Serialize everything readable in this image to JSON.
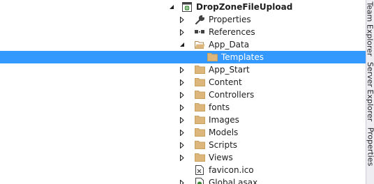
{
  "solution_explorer": {
    "project": {
      "name": "DropZoneFileUpload",
      "expanded": true,
      "icon": "web-project-icon"
    },
    "items": [
      {
        "label": "Properties",
        "icon": "wrench-icon",
        "expandable": true,
        "expanded": false,
        "level": 1,
        "selected": false
      },
      {
        "label": "References",
        "icon": "references-icon",
        "expandable": true,
        "expanded": false,
        "level": 1,
        "selected": false
      },
      {
        "label": "App_Data",
        "icon": "folder-open-icon",
        "expandable": true,
        "expanded": true,
        "level": 1,
        "selected": false
      },
      {
        "label": "Templates",
        "icon": "folder-icon",
        "expandable": false,
        "expanded": false,
        "level": 2,
        "selected": true
      },
      {
        "label": "App_Start",
        "icon": "folder-icon",
        "expandable": true,
        "expanded": false,
        "level": 1,
        "selected": false
      },
      {
        "label": "Content",
        "icon": "folder-icon",
        "expandable": true,
        "expanded": false,
        "level": 1,
        "selected": false
      },
      {
        "label": "Controllers",
        "icon": "folder-icon",
        "expandable": true,
        "expanded": false,
        "level": 1,
        "selected": false
      },
      {
        "label": "fonts",
        "icon": "folder-icon",
        "expandable": true,
        "expanded": false,
        "level": 1,
        "selected": false
      },
      {
        "label": "Images",
        "icon": "folder-icon",
        "expandable": true,
        "expanded": false,
        "level": 1,
        "selected": false
      },
      {
        "label": "Models",
        "icon": "folder-icon",
        "expandable": true,
        "expanded": false,
        "level": 1,
        "selected": false
      },
      {
        "label": "Scripts",
        "icon": "folder-icon",
        "expandable": true,
        "expanded": false,
        "level": 1,
        "selected": false
      },
      {
        "label": "Views",
        "icon": "folder-icon",
        "expandable": true,
        "expanded": false,
        "level": 1,
        "selected": false
      },
      {
        "label": "favicon.ico",
        "icon": "ico-file-icon",
        "expandable": false,
        "expanded": false,
        "level": 1,
        "selected": false
      },
      {
        "label": "Global.asax",
        "icon": "asax-file-icon",
        "expandable": true,
        "expanded": false,
        "level": 1,
        "selected": false
      }
    ]
  },
  "side_tabs": [
    {
      "label": "Team Explorer"
    },
    {
      "label": "Server Explorer"
    },
    {
      "label": "Properties"
    }
  ],
  "colors": {
    "selection": "#3399ff",
    "folder": "#dcb67a",
    "sidebar_bg": "#eeeef2"
  }
}
